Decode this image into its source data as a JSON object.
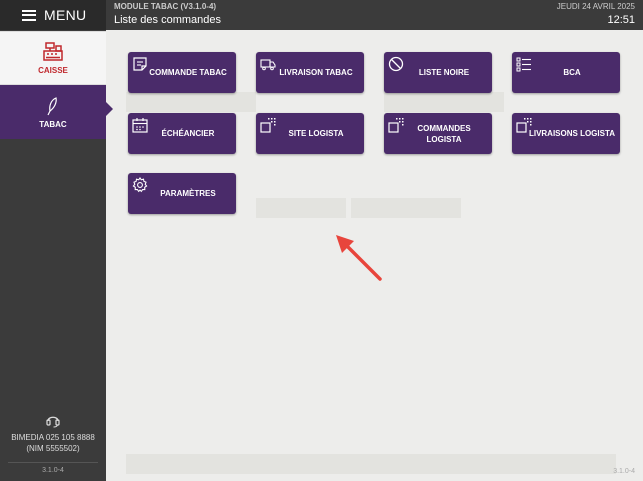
{
  "sidebar": {
    "menu_label": "MENU",
    "items": [
      {
        "label": "CAISSE",
        "icon": "cash-register-icon"
      },
      {
        "label": "TABAC",
        "icon": "leaf-icon"
      }
    ],
    "support_line1": "BIMEDIA 025 105 8888",
    "support_line2": "(NIM 5555502)",
    "version": "3.1.0-4"
  },
  "header": {
    "module": "MODULE TABAC (V3.1.0-4)",
    "title": "Liste des commandes",
    "date": "JEUDI 24 AVRIL 2025",
    "time": "12:51"
  },
  "main": {
    "version": "3.1.0-4",
    "tiles": [
      {
        "label": "COMMANDE TABAC",
        "icon": "note-icon"
      },
      {
        "label": "LIVRAISON TABAC",
        "icon": "truck-icon"
      },
      {
        "label": "LISTE NOIRE",
        "icon": "block-icon"
      },
      {
        "label": "BCA",
        "icon": "checklist-icon"
      },
      {
        "label": "ÉCHÉANCIER",
        "icon": "calendar-icon"
      },
      {
        "label": "SITE LOGISTA",
        "icon": "grid-box-icon"
      },
      {
        "label": "COMMANDES LOGISTA",
        "icon": "grid-box-icon"
      },
      {
        "label": "LIVRAISONS LOGISTA",
        "icon": "grid-box-icon"
      },
      {
        "label": "PARAMÈTRES",
        "icon": "gear-icon"
      }
    ]
  },
  "colors": {
    "accent": "#4a2b6a",
    "caisse": "#c0282d",
    "arrow": "#e8453c"
  }
}
